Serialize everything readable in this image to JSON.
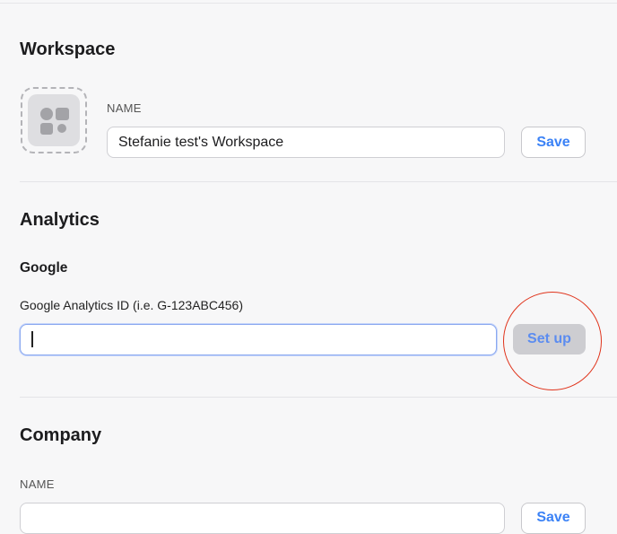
{
  "workspace": {
    "heading": "Workspace",
    "name_label": "NAME",
    "name_value": "Stefanie test's Workspace",
    "save_label": "Save"
  },
  "analytics": {
    "heading": "Analytics",
    "google_heading": "Google",
    "ga_label": "Google Analytics ID (i.e. G-123ABC456)",
    "ga_value": "",
    "setup_label": "Set up"
  },
  "company": {
    "heading": "Company",
    "name_label": "NAME",
    "name_value": "",
    "save_label": "Save"
  },
  "annotation": {
    "circle_color": "#e0341c"
  }
}
